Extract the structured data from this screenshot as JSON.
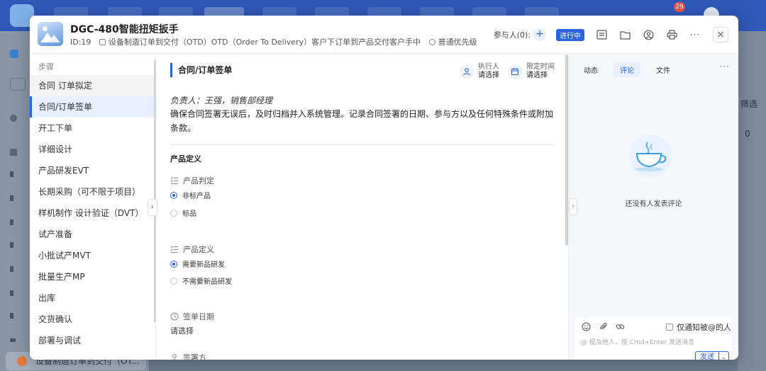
{
  "background": {
    "top_badge_count": "29",
    "side_pill_label": "设备制造订单到交付（OT...",
    "right_filter": "筛选",
    "right_zero": "0"
  },
  "header": {
    "title": "DGC-480智能扭矩扳手",
    "id_text": "ID:19",
    "process_name": "设备制造订单到交付（OTD）OTD（Order To Delivery）客户下订单到产品交付客户手中",
    "priority": "普通优先级",
    "participants_label": "参与人(0):",
    "add_symbol": "+",
    "status": "进行中",
    "close_symbol": "×"
  },
  "steps": {
    "heading": "步骤",
    "items": [
      {
        "label": "合同 订单拟定",
        "state": "done"
      },
      {
        "label": "合同/订单签单",
        "state": "active"
      },
      {
        "label": "开工下单",
        "state": "todo"
      },
      {
        "label": "详细设计",
        "state": "todo"
      },
      {
        "label": "产品研发EVT",
        "state": "todo"
      },
      {
        "label": "长期采购（可不限于项目）",
        "state": "todo"
      },
      {
        "label": "样机制作 设计验证（DVT）",
        "state": "todo"
      },
      {
        "label": "试产准备",
        "state": "todo"
      },
      {
        "label": "小批试产MVT",
        "state": "todo"
      },
      {
        "label": "批量生产MP",
        "state": "todo"
      },
      {
        "label": "出库",
        "state": "todo"
      },
      {
        "label": "交货确认",
        "state": "todo"
      },
      {
        "label": "部署与调试",
        "state": "todo"
      }
    ],
    "collapse_symbol": "‹"
  },
  "main": {
    "section_title": "合同/订单签单",
    "executor_label": "执行人",
    "executor_value": "请选择",
    "deadline_label": "限定时间",
    "deadline_value": "请选择",
    "owner_line": "负责人：王强，销售部经理",
    "description": "确保合同签署无误后，及时归档并入系统管理。记录合同签署的日期、参与方以及任何特殊条件或附加条款。",
    "product_def_heading": "产品定义",
    "field1_label": "产品判定",
    "field1_options": [
      "非标产品",
      "标品"
    ],
    "field1_selected": "非标产品",
    "field2_label": "产品定义",
    "field2_options": [
      "需要新品研发",
      "不需要新品研发"
    ],
    "field2_selected": "需要新品研发",
    "sign_date_label": "签单日期",
    "sign_date_value": "请选择",
    "signer_label": "签署方",
    "expand_symbol": "›"
  },
  "comments": {
    "tabs": [
      "动态",
      "评论",
      "文件"
    ],
    "active_tab": "评论",
    "more_symbol": "···",
    "empty_text": "还没有人发表评论",
    "notify_only_label": "仅通知被@的人",
    "input_placeholder": "@ 提及他人，按 Cmd+Enter 发送消息",
    "send_label": "发送",
    "send_drop_symbol": "⌄"
  },
  "colors": {
    "accent": "#2a62e6",
    "topbar": "#2f58b8"
  }
}
